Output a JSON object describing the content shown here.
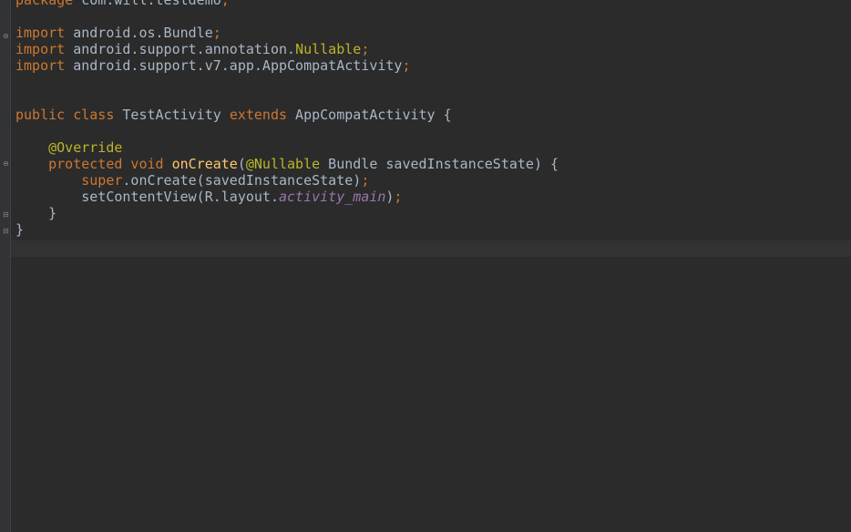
{
  "editor": {
    "language": "Java",
    "colors": {
      "background": "#2b2b2b",
      "keyword": "#cc7832",
      "annotation": "#bbb529",
      "method": "#ffc66d",
      "static_field": "#9876aa",
      "text": "#a9b7c6"
    },
    "fold_markers": [
      "fold-open-icon",
      "fold-open-icon",
      "fold-end-icon",
      "fold-end-icon"
    ],
    "lines": [
      {
        "tokens": [
          {
            "t": "package",
            "c": "kw"
          },
          {
            "t": " com.will.testdemo",
            "c": "plain"
          },
          {
            "t": ";",
            "c": "kw"
          }
        ]
      },
      {
        "tokens": []
      },
      {
        "tokens": [
          {
            "t": "import",
            "c": "kw"
          },
          {
            "t": " android.os.Bundle",
            "c": "plain"
          },
          {
            "t": ";",
            "c": "kw"
          }
        ]
      },
      {
        "tokens": [
          {
            "t": "import",
            "c": "kw"
          },
          {
            "t": " android.support.annotation.",
            "c": "plain"
          },
          {
            "t": "Nullable",
            "c": "ann"
          },
          {
            "t": ";",
            "c": "kw"
          }
        ]
      },
      {
        "tokens": [
          {
            "t": "import",
            "c": "kw"
          },
          {
            "t": " android.support.v7.app.AppCompatActivity",
            "c": "plain"
          },
          {
            "t": ";",
            "c": "kw"
          }
        ]
      },
      {
        "tokens": []
      },
      {
        "tokens": []
      },
      {
        "tokens": [
          {
            "t": "public class",
            "c": "kw"
          },
          {
            "t": " TestActivity ",
            "c": "plain"
          },
          {
            "t": "extends",
            "c": "kw"
          },
          {
            "t": " AppCompatActivity {",
            "c": "plain"
          }
        ]
      },
      {
        "tokens": []
      },
      {
        "tokens": [
          {
            "t": "    ",
            "c": "plain"
          },
          {
            "t": "@Override",
            "c": "ann"
          }
        ]
      },
      {
        "tokens": [
          {
            "t": "    ",
            "c": "plain"
          },
          {
            "t": "protected void",
            "c": "kw"
          },
          {
            "t": " ",
            "c": "plain"
          },
          {
            "t": "onCreate",
            "c": "fn"
          },
          {
            "t": "(",
            "c": "plain"
          },
          {
            "t": "@Nullable",
            "c": "ann"
          },
          {
            "t": " Bundle savedInstanceState) {",
            "c": "plain"
          }
        ]
      },
      {
        "tokens": [
          {
            "t": "        ",
            "c": "plain"
          },
          {
            "t": "super",
            "c": "kw"
          },
          {
            "t": ".onCreate(savedInstanceState)",
            "c": "plain"
          },
          {
            "t": ";",
            "c": "kw"
          }
        ]
      },
      {
        "tokens": [
          {
            "t": "        setContentView(R.layout.",
            "c": "plain"
          },
          {
            "t": "activity_main",
            "c": "field"
          },
          {
            "t": ")",
            "c": "plain"
          },
          {
            "t": ";",
            "c": "kw"
          }
        ]
      },
      {
        "tokens": [
          {
            "t": "    }",
            "c": "plain"
          }
        ]
      },
      {
        "tokens": [
          {
            "t": "}",
            "c": "plain"
          }
        ]
      },
      {
        "tokens": []
      }
    ]
  }
}
